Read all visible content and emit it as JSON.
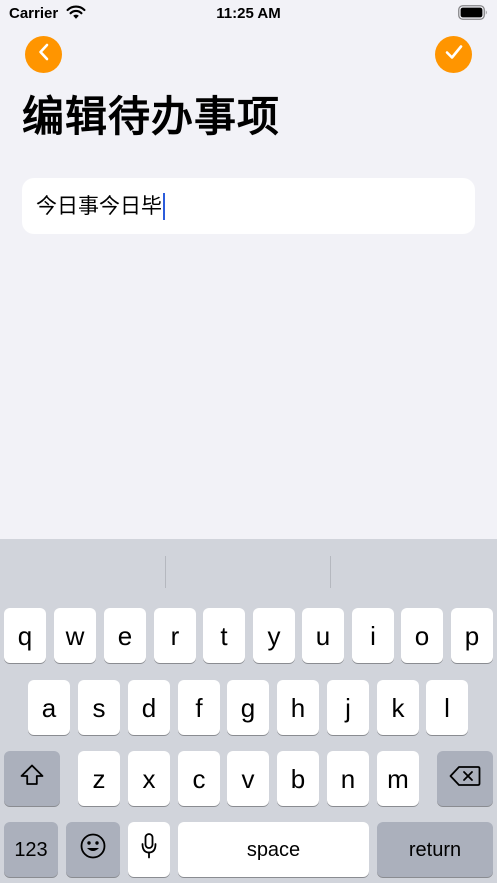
{
  "status_bar": {
    "carrier": "Carrier",
    "time": "11:25 AM",
    "icons": [
      "wifi-icon",
      "battery-icon"
    ]
  },
  "nav": {
    "back_icon": "chevron-left-icon",
    "done_icon": "checkmark-icon",
    "accent_color": "#ff9500"
  },
  "page": {
    "title": "编辑待办事项"
  },
  "todo_input": {
    "value": "今日事今日毕"
  },
  "keyboard": {
    "row1": [
      "q",
      "w",
      "e",
      "r",
      "t",
      "y",
      "u",
      "i",
      "o",
      "p"
    ],
    "row2": [
      "a",
      "s",
      "d",
      "f",
      "g",
      "h",
      "j",
      "k",
      "l"
    ],
    "row3": [
      "z",
      "x",
      "c",
      "v",
      "b",
      "n",
      "m"
    ],
    "shift_icon": "shift-icon",
    "delete_icon": "backspace-icon",
    "numbers_label": "123",
    "emoji_icon": "emoji-icon",
    "mic_icon": "microphone-icon",
    "space_label": "space",
    "return_label": "return"
  }
}
